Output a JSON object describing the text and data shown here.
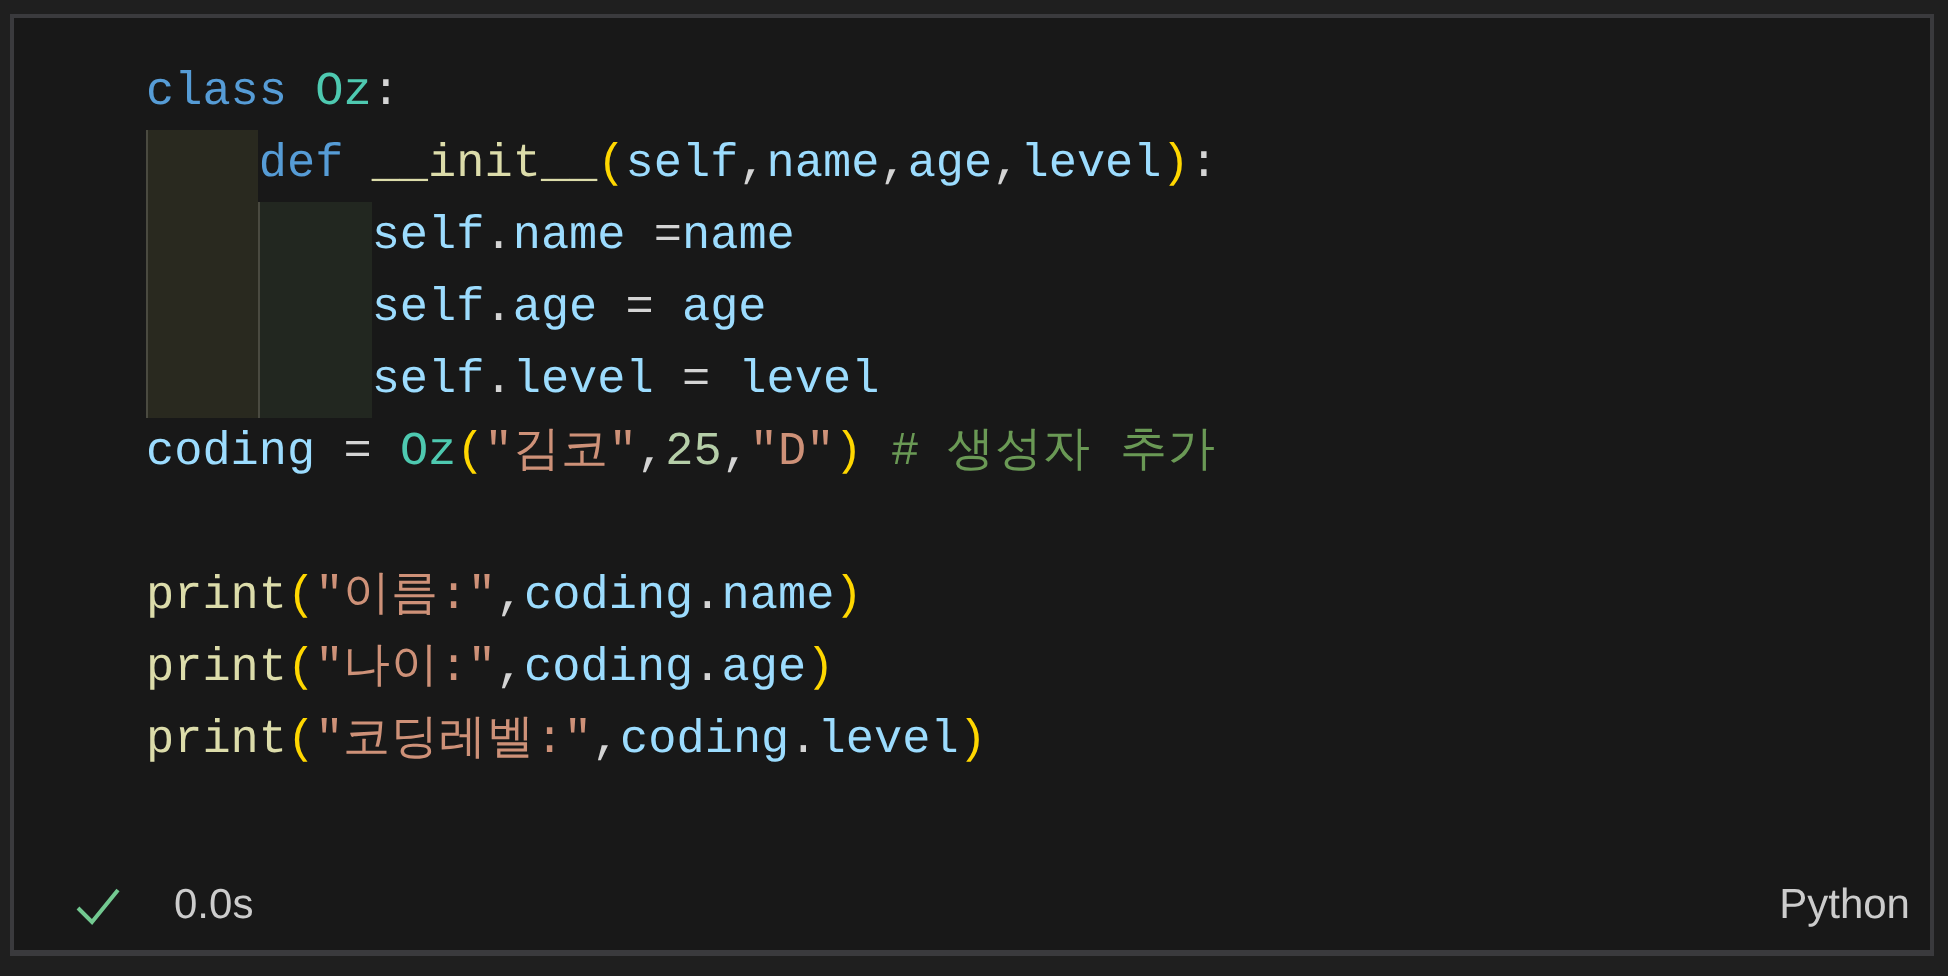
{
  "cell": {
    "lines": [
      {
        "kind": "code",
        "tokens": [
          {
            "kind": "keyword",
            "text": "class "
          },
          {
            "kind": "class",
            "text": "Oz"
          },
          {
            "kind": "punct",
            "text": ":"
          }
        ],
        "children": [
          {
            "kind": "code",
            "tokens": [
              {
                "kind": "keyword",
                "text": "def "
              },
              {
                "kind": "function",
                "text": "__init__"
              },
              {
                "kind": "paren",
                "text": "("
              },
              {
                "kind": "variable",
                "text": "self"
              },
              {
                "kind": "punct",
                "text": ","
              },
              {
                "kind": "variable",
                "text": "name"
              },
              {
                "kind": "punct",
                "text": ","
              },
              {
                "kind": "variable",
                "text": "age"
              },
              {
                "kind": "punct",
                "text": ","
              },
              {
                "kind": "variable",
                "text": "level"
              },
              {
                "kind": "paren",
                "text": ")"
              },
              {
                "kind": "punct",
                "text": ":"
              }
            ],
            "children": [
              {
                "kind": "code",
                "tokens": [
                  {
                    "kind": "variable",
                    "text": "self"
                  },
                  {
                    "kind": "punct",
                    "text": "."
                  },
                  {
                    "kind": "variable",
                    "text": "name"
                  },
                  {
                    "kind": "punct",
                    "text": " ="
                  },
                  {
                    "kind": "variable",
                    "text": "name"
                  }
                ]
              },
              {
                "kind": "code",
                "tokens": [
                  {
                    "kind": "variable",
                    "text": "self"
                  },
                  {
                    "kind": "punct",
                    "text": "."
                  },
                  {
                    "kind": "variable",
                    "text": "age"
                  },
                  {
                    "kind": "punct",
                    "text": " = "
                  },
                  {
                    "kind": "variable",
                    "text": "age"
                  }
                ]
              },
              {
                "kind": "code",
                "tokens": [
                  {
                    "kind": "variable",
                    "text": "self"
                  },
                  {
                    "kind": "punct",
                    "text": "."
                  },
                  {
                    "kind": "variable",
                    "text": "level"
                  },
                  {
                    "kind": "punct",
                    "text": " = "
                  },
                  {
                    "kind": "variable",
                    "text": "level"
                  }
                ]
              }
            ]
          }
        ]
      },
      {
        "kind": "code",
        "tokens": [
          {
            "kind": "variable",
            "text": "coding"
          },
          {
            "kind": "punct",
            "text": " = "
          },
          {
            "kind": "class",
            "text": "Oz"
          },
          {
            "kind": "paren",
            "text": "("
          },
          {
            "kind": "string",
            "text": "\"김코\""
          },
          {
            "kind": "punct",
            "text": ","
          },
          {
            "kind": "number",
            "text": "25"
          },
          {
            "kind": "punct",
            "text": ","
          },
          {
            "kind": "string",
            "text": "\"D\""
          },
          {
            "kind": "paren",
            "text": ")"
          },
          {
            "kind": "comment",
            "text": " # 생성자 추가"
          }
        ]
      },
      {
        "kind": "blank"
      },
      {
        "kind": "code",
        "tokens": [
          {
            "kind": "function",
            "text": "print"
          },
          {
            "kind": "paren",
            "text": "("
          },
          {
            "kind": "string",
            "text": "\"이름:\""
          },
          {
            "kind": "punct",
            "text": ","
          },
          {
            "kind": "variable",
            "text": "coding"
          },
          {
            "kind": "punct",
            "text": "."
          },
          {
            "kind": "variable",
            "text": "name"
          },
          {
            "kind": "paren",
            "text": ")"
          }
        ]
      },
      {
        "kind": "code",
        "tokens": [
          {
            "kind": "function",
            "text": "print"
          },
          {
            "kind": "paren",
            "text": "("
          },
          {
            "kind": "string",
            "text": "\"나이:\""
          },
          {
            "kind": "punct",
            "text": ","
          },
          {
            "kind": "variable",
            "text": "coding"
          },
          {
            "kind": "punct",
            "text": "."
          },
          {
            "kind": "variable",
            "text": "age"
          },
          {
            "kind": "paren",
            "text": ")"
          }
        ]
      },
      {
        "kind": "code",
        "tokens": [
          {
            "kind": "function",
            "text": "print"
          },
          {
            "kind": "paren",
            "text": "("
          },
          {
            "kind": "string",
            "text": "\"코딩레벨:\""
          },
          {
            "kind": "punct",
            "text": ","
          },
          {
            "kind": "variable",
            "text": "coding"
          },
          {
            "kind": "punct",
            "text": "."
          },
          {
            "kind": "variable",
            "text": "level"
          },
          {
            "kind": "paren",
            "text": ")"
          }
        ]
      }
    ]
  },
  "status": {
    "succeeded": true,
    "duration": "0.0s",
    "language": "Python"
  }
}
